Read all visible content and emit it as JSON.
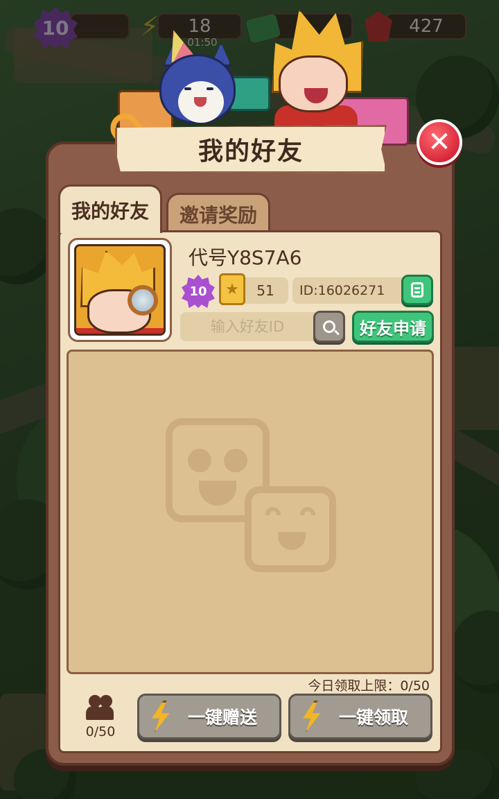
{
  "hud": {
    "level": "10",
    "energy": "18",
    "energy_timer": "01:50",
    "gems": "427",
    "icons": [
      "level-badge-icon",
      "lightning-icon",
      "cash-icon",
      "gem-icon"
    ]
  },
  "dialog": {
    "title": "我的好友",
    "close_icon": "close-icon",
    "tabs": [
      {
        "label": "我的好友",
        "active": true
      },
      {
        "label": "邀请奖励",
        "active": false
      }
    ]
  },
  "profile": {
    "name": "代号Y8S7A6",
    "level": "10",
    "stars": "51",
    "id_text": "ID:16026271",
    "copy_icon": "copy-icon"
  },
  "search": {
    "placeholder": "输入好友ID",
    "search_icon": "search-icon",
    "apply_label": "好友申请"
  },
  "friends": {
    "items": [],
    "empty_icon": "smiley-faces-icon",
    "daily_limit_text": "今日领取上限：0/50",
    "count_text": "0/50"
  },
  "actions": {
    "gift_all_label": "一键赠送",
    "claim_all_label": "一键领取",
    "icon": "lightning-icon"
  },
  "colors": {
    "panel": "#8b5c4a",
    "panel_inner": "#f1e2c4",
    "green_button": "#3fc57b",
    "close_button": "#d8283a",
    "disabled_button": "#a29b92"
  }
}
